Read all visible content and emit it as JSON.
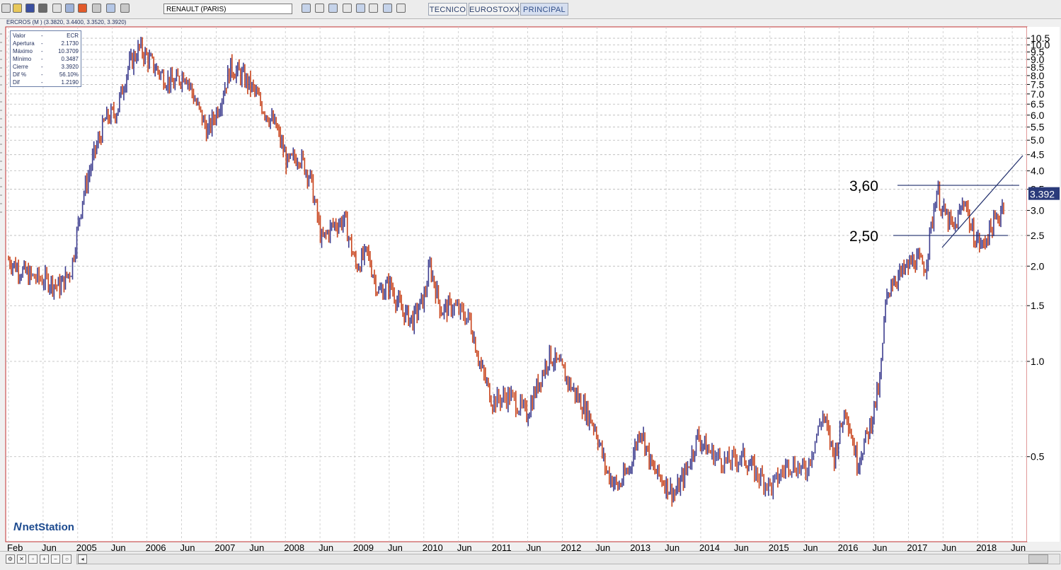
{
  "toolbar": {
    "symbol_input": "RENAULT (PARIS)",
    "tabs": [
      {
        "label": "TECNICO",
        "active": false
      },
      {
        "label": "EUROSTOXX",
        "active": false
      },
      {
        "label": "PRINCIPAL",
        "active": true
      }
    ],
    "icons": [
      "new-icon",
      "open-icon",
      "save-icon",
      "print-icon",
      "copy-icon",
      "layers-icon",
      "pie-icon",
      "text-icon",
      "image-icon",
      "pen-icon"
    ],
    "right_icons": [
      "window-icon",
      "config-icon",
      "compare-icon",
      "grid-icon",
      "chart-icon",
      "indicator-icon",
      "draw-icon",
      "help-icon"
    ]
  },
  "chart_title": "ERCROS (M ) (3.3820, 3.4400, 3.3520, 3.3920)",
  "info_panel": [
    {
      "key": "Valor",
      "dash": "-",
      "value": "ECR"
    },
    {
      "key": "Apertura",
      "dash": "-",
      "value": "2.1730"
    },
    {
      "key": "Máximo",
      "dash": "-",
      "value": "10.3709"
    },
    {
      "key": "Mínimo",
      "dash": "-",
      "value": "0.3487"
    },
    {
      "key": "Cierre",
      "dash": "-",
      "value": "3.3920"
    },
    {
      "key": "Dif %",
      "dash": "-",
      "value": "56.10%"
    },
    {
      "key": "Dif",
      "dash": "-",
      "value": "1.2190"
    }
  ],
  "logo": {
    "mark": "N",
    "text": "netStation"
  },
  "colors": {
    "up": "#3d3d8f",
    "down": "#c8431b",
    "last_price_bg": "#2a3a7a",
    "trend_line": "#1f2d6b",
    "frame": "#c03030"
  },
  "chart_data": {
    "type": "line",
    "title": "ERCROS (M ) (3.3820, 3.4400, 3.3520, 3.3920)",
    "y_scale": "log",
    "ylim": [
      0.3,
      11.0
    ],
    "y_ticks": [
      "10.5",
      "10.0",
      "9.5",
      "9.0",
      "8.5",
      "8.0",
      "7.5",
      "7.0",
      "6.5",
      "6.0",
      "5.5",
      "5.0",
      "4.5",
      "4.0",
      "3.5",
      "3.0",
      "2.5",
      "2.0",
      "1.5",
      "1.0",
      "0.5"
    ],
    "x_labels": [
      "Feb",
      "Jun",
      "2005",
      "Jun",
      "2006",
      "Jun",
      "2007",
      "Jun",
      "2008",
      "Jun",
      "2009",
      "Jun",
      "2010",
      "Jun",
      "2011",
      "Jun",
      "2012",
      "Jun",
      "2013",
      "Jun",
      "2014",
      "Jun",
      "2015",
      "Jun",
      "2016",
      "Jun",
      "2017",
      "Jun",
      "2018",
      "Jun"
    ],
    "x_range": [
      "2004-02",
      "2018-09"
    ],
    "series": [
      {
        "values": [
          [
            "2004-02",
            2.1
          ],
          [
            "2004-04",
            1.95
          ],
          [
            "2004-06",
            1.85
          ],
          [
            "2004-09",
            1.8
          ],
          [
            "2004-11",
            1.72
          ],
          [
            "2005-01",
            1.95
          ],
          [
            "2005-03",
            3.3
          ],
          [
            "2005-05",
            4.5
          ],
          [
            "2005-07",
            5.8
          ],
          [
            "2005-09",
            6.2
          ],
          [
            "2005-11",
            8.5
          ],
          [
            "2006-01",
            9.8
          ],
          [
            "2006-03",
            8.8
          ],
          [
            "2006-05",
            8.0
          ],
          [
            "2006-07",
            7.5
          ],
          [
            "2006-09",
            8.2
          ],
          [
            "2006-11",
            6.5
          ],
          [
            "2007-01",
            5.3
          ],
          [
            "2007-03",
            6.5
          ],
          [
            "2007-05",
            8.5
          ],
          [
            "2007-07",
            8.0
          ],
          [
            "2007-09",
            7.2
          ],
          [
            "2007-11",
            6.2
          ],
          [
            "2008-01",
            5.5
          ],
          [
            "2008-03",
            4.2
          ],
          [
            "2008-05",
            4.5
          ],
          [
            "2008-07",
            3.8
          ],
          [
            "2008-09",
            2.4
          ],
          [
            "2008-11",
            2.7
          ],
          [
            "2009-01",
            2.8
          ],
          [
            "2009-03",
            2.0
          ],
          [
            "2009-05",
            2.2
          ],
          [
            "2009-07",
            1.65
          ],
          [
            "2009-09",
            1.75
          ],
          [
            "2009-11",
            1.45
          ],
          [
            "2010-01",
            1.35
          ],
          [
            "2010-03",
            1.6
          ],
          [
            "2010-04",
            2.0
          ],
          [
            "2010-06",
            1.45
          ],
          [
            "2010-08",
            1.5
          ],
          [
            "2010-11",
            1.35
          ],
          [
            "2011-01",
            0.95
          ],
          [
            "2011-03",
            0.75
          ],
          [
            "2011-06",
            0.78
          ],
          [
            "2011-09",
            0.68
          ],
          [
            "2011-11",
            0.85
          ],
          [
            "2012-01",
            1.05
          ],
          [
            "2012-03",
            0.95
          ],
          [
            "2012-05",
            0.82
          ],
          [
            "2012-07",
            0.72
          ],
          [
            "2012-09",
            0.62
          ],
          [
            "2012-11",
            0.45
          ],
          [
            "2013-01",
            0.4
          ],
          [
            "2013-03",
            0.46
          ],
          [
            "2013-05",
            0.62
          ],
          [
            "2013-07",
            0.46
          ],
          [
            "2013-09",
            0.42
          ],
          [
            "2013-11",
            0.38
          ],
          [
            "2014-01",
            0.45
          ],
          [
            "2014-03",
            0.58
          ],
          [
            "2014-05",
            0.52
          ],
          [
            "2014-08",
            0.48
          ],
          [
            "2014-11",
            0.5
          ],
          [
            "2015-01",
            0.45
          ],
          [
            "2015-04",
            0.4
          ],
          [
            "2015-07",
            0.48
          ],
          [
            "2015-10",
            0.45
          ],
          [
            "2016-01",
            0.68
          ],
          [
            "2016-03",
            0.5
          ],
          [
            "2016-05",
            0.72
          ],
          [
            "2016-07",
            0.48
          ],
          [
            "2016-09",
            0.6
          ],
          [
            "2016-11",
            0.85
          ],
          [
            "2016-12",
            1.5
          ],
          [
            "2017-01",
            1.8
          ],
          [
            "2017-03",
            1.9
          ],
          [
            "2017-05",
            2.1
          ],
          [
            "2017-07",
            2.0
          ],
          [
            "2017-09",
            3.5
          ],
          [
            "2017-10",
            3.0
          ],
          [
            "2017-12",
            2.6
          ],
          [
            "2018-02",
            3.3
          ],
          [
            "2018-03",
            2.6
          ],
          [
            "2018-05",
            2.3
          ],
          [
            "2018-06",
            2.55
          ],
          [
            "2018-08",
            2.9
          ],
          [
            "2018-09",
            3.392
          ]
        ]
      }
    ],
    "last_price": "3.392",
    "annotations": [
      {
        "text": "3,60",
        "value": 3.6
      },
      {
        "text": "2,50",
        "value": 2.5
      }
    ],
    "grid": true
  }
}
